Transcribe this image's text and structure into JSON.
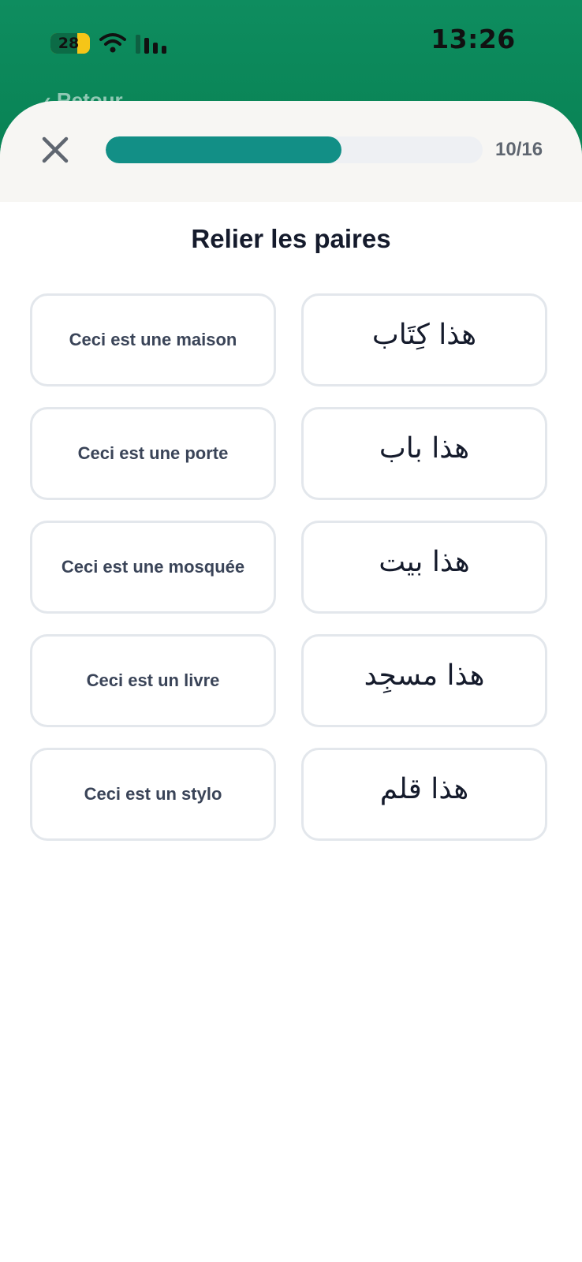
{
  "status_bar": {
    "battery": "28",
    "time": "13:26"
  },
  "background_nav": {
    "peek_text": "‹ Retour"
  },
  "header": {
    "close_icon": "close-icon",
    "progress_current": 10,
    "progress_total": 16,
    "progress_label": "10/16"
  },
  "exercise": {
    "title": "Relier les paires",
    "left_items": [
      "Ceci est une maison",
      "Ceci est une porte",
      "Ceci est une mosquée",
      "Ceci est un livre",
      "Ceci est un stylo"
    ],
    "right_items": [
      "هذا كِتَاب",
      "هذا باب",
      "هذا بيت",
      "هذا مسجِد",
      "هذا قلم"
    ]
  },
  "colors": {
    "header_green": "#0e8d5f",
    "progress_fill": "#128f86",
    "card_border": "#e3e7ec"
  }
}
